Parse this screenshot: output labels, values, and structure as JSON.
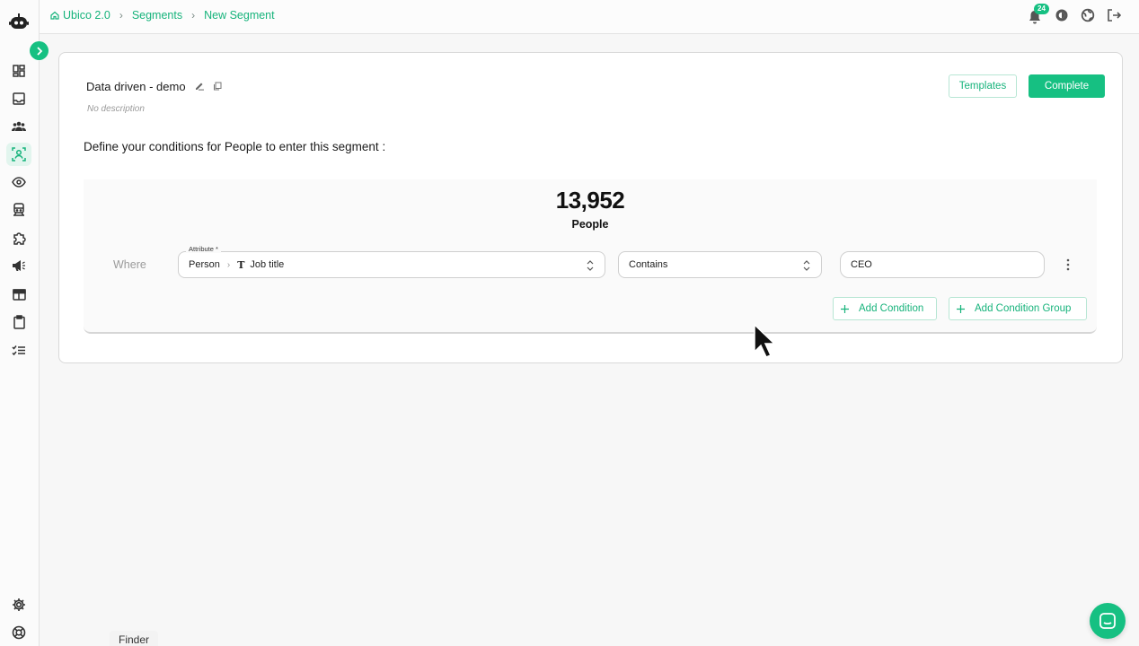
{
  "breadcrumb": {
    "items": [
      "Ubico 2.0",
      "Segments",
      "New Segment"
    ]
  },
  "notifications": {
    "count": "24"
  },
  "segment": {
    "name": "Data driven - demo",
    "description": "No description"
  },
  "header_buttons": {
    "templates": "Templates",
    "complete": "Complete"
  },
  "conditions": {
    "heading": "Define your conditions for People to enter this segment :",
    "count": "13,952",
    "count_label": "People",
    "where_label": "Where",
    "attribute_label": "Attribute *",
    "attribute_entity": "Person",
    "attribute_field": "Job title",
    "operator": "Contains",
    "value": "CEO",
    "add_condition": "Add Condition",
    "add_condition_group": "Add Condition Group"
  },
  "finder": "Finder",
  "colors": {
    "accent": "#16c082",
    "accent_text": "#16b37b"
  },
  "icons": {
    "sidebar": [
      "dashboard-icon",
      "inbox-icon",
      "people-icon",
      "segments-icon",
      "eye-icon",
      "train-icon",
      "puzzle-icon",
      "megaphone-icon",
      "table-icon",
      "clipboard-icon",
      "checklist-icon",
      "gear-icon",
      "help-icon"
    ],
    "top": [
      "bell-icon",
      "theme-icon",
      "globe-icon",
      "logout-icon"
    ]
  }
}
